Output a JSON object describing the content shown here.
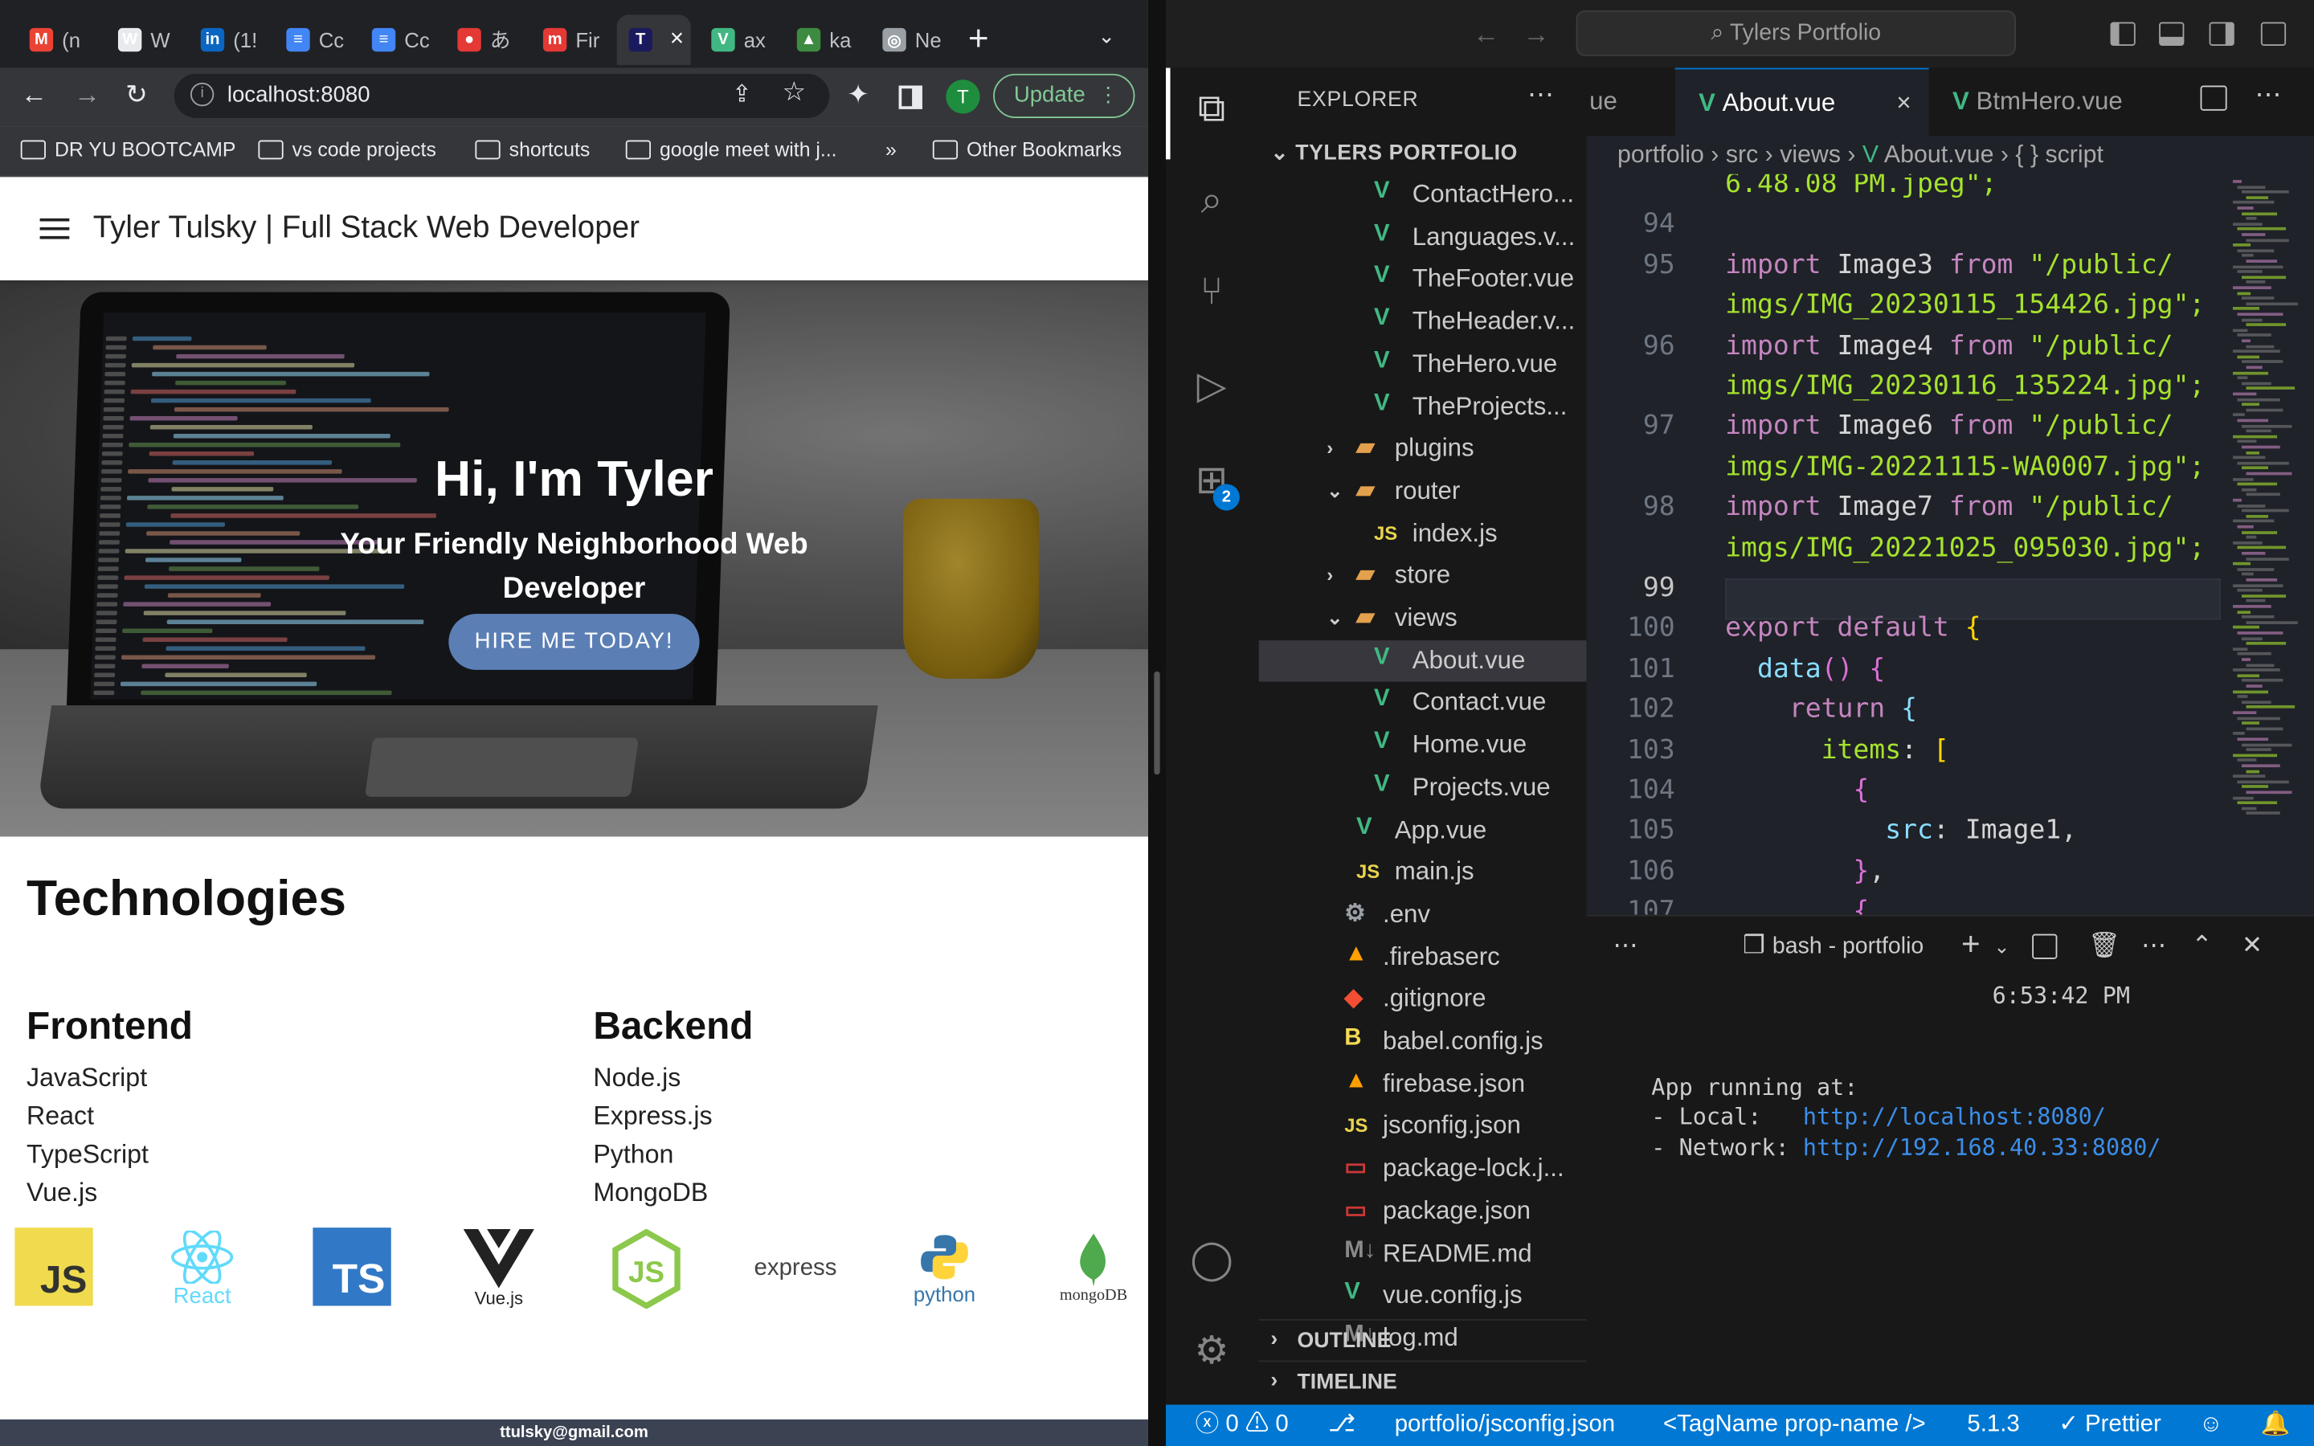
{
  "browser": {
    "tabs": [
      {
        "icon": "gmail-icon",
        "label": "(n",
        "color": "#ea4335",
        "glyph": "M"
      },
      {
        "icon": "wikipedia-icon",
        "label": "W",
        "color": "#e8eaed",
        "glyph": "W"
      },
      {
        "icon": "linkedin-icon",
        "label": "(1!",
        "color": "#0a66c2",
        "glyph": "in"
      },
      {
        "icon": "docs-icon",
        "label": "Cc",
        "color": "#4285f4",
        "glyph": "≡"
      },
      {
        "icon": "docs-icon",
        "label": "Cc",
        "color": "#4285f4",
        "glyph": "≡"
      },
      {
        "icon": "app-icon",
        "label": "あ",
        "color": "#e53935",
        "glyph": "●"
      },
      {
        "icon": "m-icon",
        "label": "Fir",
        "color": "#e53935",
        "glyph": "m"
      },
      {
        "icon": "t-icon",
        "label": "",
        "color": "#1a1a5e",
        "glyph": "T",
        "active": true
      },
      {
        "icon": "vue-icon",
        "label": "ax",
        "color": "#41b883",
        "glyph": "V"
      },
      {
        "icon": "image-icon",
        "label": "ka",
        "color": "#3d8b40",
        "glyph": "▲"
      },
      {
        "icon": "chrome-icon",
        "label": "Ne",
        "color": "#9aa0a6",
        "glyph": "◎"
      }
    ],
    "url": "localhost:8080",
    "update_label": "Update",
    "profile_initial": "T",
    "bookmarks": [
      "DR YU BOOTCAMP",
      "vs code projects",
      "shortcuts",
      "google meet with j...",
      "Other Bookmarks"
    ],
    "bookmarks_more": "»"
  },
  "site": {
    "title": "Tyler Tulsky | Full Stack Web Developer",
    "hero_title": "Hi, I'm Tyler",
    "hero_subtitle": "Your Friendly Neighborhood Web Developer",
    "hire_button": "HIRE ME TODAY!",
    "tech_heading": "Technologies",
    "frontend_heading": "Frontend",
    "frontend": [
      "JavaScript",
      "React",
      "TypeScript",
      "Vue.js"
    ],
    "backend_heading": "Backend",
    "backend": [
      "Node.js",
      "Express.js",
      "Python",
      "MongoDB"
    ],
    "logos": [
      {
        "name": "javascript-logo",
        "text": "JS"
      },
      {
        "name": "react-logo",
        "text": "React"
      },
      {
        "name": "typescript-logo",
        "text": "TS"
      },
      {
        "name": "vuejs-logo",
        "text": "Vue.js"
      },
      {
        "name": "nodejs-logo",
        "text": "JS"
      },
      {
        "name": "express-logo",
        "text": "express"
      },
      {
        "name": "python-logo",
        "text": "python"
      },
      {
        "name": "mongodb-logo",
        "text": "mongoDB"
      }
    ],
    "footer_email": "ttulsky@gmail.com"
  },
  "vscode": {
    "command_center": "Tylers Portfolio",
    "explorer_label": "EXPLORER",
    "project_label": "TYLERS PORTFOLIO",
    "tree": [
      {
        "label": "ContactHero...",
        "icon": "vue",
        "indent": 3
      },
      {
        "label": "Languages.v...",
        "icon": "vue",
        "indent": 3
      },
      {
        "label": "TheFooter.vue",
        "icon": "vue",
        "indent": 3
      },
      {
        "label": "TheHeader.v...",
        "icon": "vue",
        "indent": 3
      },
      {
        "label": "TheHero.vue",
        "icon": "vue",
        "indent": 3
      },
      {
        "label": "TheProjects...",
        "icon": "vue",
        "indent": 3
      },
      {
        "label": "plugins",
        "icon": "folder",
        "indent": 2,
        "chev": "›"
      },
      {
        "label": "router",
        "icon": "folder",
        "indent": 2,
        "chev": "⌄"
      },
      {
        "label": "index.js",
        "icon": "js",
        "indent": 3
      },
      {
        "label": "store",
        "icon": "folder",
        "indent": 2,
        "chev": "›"
      },
      {
        "label": "views",
        "icon": "folder",
        "indent": 2,
        "chev": "⌄"
      },
      {
        "label": "About.vue",
        "icon": "vue",
        "indent": 3,
        "selected": true
      },
      {
        "label": "Contact.vue",
        "icon": "vue",
        "indent": 3
      },
      {
        "label": "Home.vue",
        "icon": "vue",
        "indent": 3
      },
      {
        "label": "Projects.vue",
        "icon": "vue",
        "indent": 3
      },
      {
        "label": "App.vue",
        "icon": "vue",
        "indent": 2
      },
      {
        "label": "main.js",
        "icon": "js",
        "indent": 2
      },
      {
        "label": ".env",
        "icon": "gear",
        "indent": 1
      },
      {
        "label": ".firebaserc",
        "icon": "firebase",
        "indent": 1
      },
      {
        "label": ".gitignore",
        "icon": "git",
        "indent": 1
      },
      {
        "label": "babel.config.js",
        "icon": "babel",
        "indent": 1
      },
      {
        "label": "firebase.json",
        "icon": "firebase",
        "indent": 1
      },
      {
        "label": "jsconfig.json",
        "icon": "js",
        "indent": 1
      },
      {
        "label": "package-lock.j...",
        "icon": "npm",
        "indent": 1
      },
      {
        "label": "package.json",
        "icon": "npm",
        "indent": 1
      },
      {
        "label": "README.md",
        "icon": "md",
        "indent": 1
      },
      {
        "label": "vue.config.js",
        "icon": "vue",
        "indent": 1
      },
      {
        "label": "log.md",
        "icon": "md",
        "indent": 1
      }
    ],
    "outline_label": "OUTLINE",
    "timeline_label": "TIMELINE",
    "extensions_badge": "2",
    "tabs": [
      {
        "label": "ue",
        "icon": false
      },
      {
        "label": "About.vue",
        "icon": true,
        "active": true
      },
      {
        "label": "BtmHero.vue",
        "icon": true
      }
    ],
    "breadcrumbs": [
      "portfolio",
      "src",
      "views",
      "About.vue",
      "{ } script"
    ],
    "code_lines": [
      {
        "n": "",
        "html": "<span class='str'>6.48.08 PM.jpeg\";</span>"
      },
      {
        "n": "94",
        "html": ""
      },
      {
        "n": "95",
        "html": "<span class='kw'>import</span> Image3 <span class='kw'>from</span> <span class='str'>\"/public/</span>"
      },
      {
        "n": "",
        "html": "<span class='str'>imgs/IMG_20230115_154426.jpg\";</span>"
      },
      {
        "n": "96",
        "html": "<span class='kw'>import</span> Image4 <span class='kw'>from</span> <span class='str'>\"/public/</span>"
      },
      {
        "n": "",
        "html": "<span class='str'>imgs/IMG_20230116_135224.jpg\";</span>"
      },
      {
        "n": "97",
        "html": "<span class='kw'>import</span> Image6 <span class='kw'>from</span> <span class='str'>\"/public/</span>"
      },
      {
        "n": "",
        "html": "<span class='str'>imgs/IMG-20221115-WA0007.jpg\";</span>"
      },
      {
        "n": "98",
        "html": "<span class='kw'>import</span> Image7 <span class='kw'>from</span> <span class='str'>\"/public/</span>"
      },
      {
        "n": "",
        "html": "<span class='str'>imgs/IMG_20221025_095030.jpg\";</span>"
      },
      {
        "n": "99",
        "html": ""
      },
      {
        "n": "100",
        "html": "<span class='kw'>export default</span> <span class='br'>{</span>"
      },
      {
        "n": "101",
        "html": "  <span class='prop'>data</span><span class='br2'>()</span> <span class='br2'>{</span>"
      },
      {
        "n": "102",
        "html": "    <span class='kw'>return</span> <span class='prop'>{</span>"
      },
      {
        "n": "103",
        "html": "      <span class='str'>items</span>: <span class='br'>[</span>"
      },
      {
        "n": "104",
        "html": "        <span class='br2'>{</span>"
      },
      {
        "n": "105",
        "html": "          <span class='prop'>src</span>: Image1,"
      },
      {
        "n": "106",
        "html": "        <span class='br2'>}</span>,"
      },
      {
        "n": "107",
        "html": "        <span class='br2'>{</span>"
      }
    ],
    "terminal_title": "bash - portfolio",
    "terminal_lines": [
      "6:53:42 PM",
      "",
      "",
      "App running at:",
      "- Local:   http://localhost:8080/",
      "- Network: http://192.168.40.33:8080/"
    ],
    "status": {
      "errors": "0",
      "warnings": "0",
      "file": "portfolio/jsconfig.json",
      "tagname": "<TagName prop-name />",
      "version": "5.1.3",
      "prettier": "✓ Prettier"
    }
  }
}
